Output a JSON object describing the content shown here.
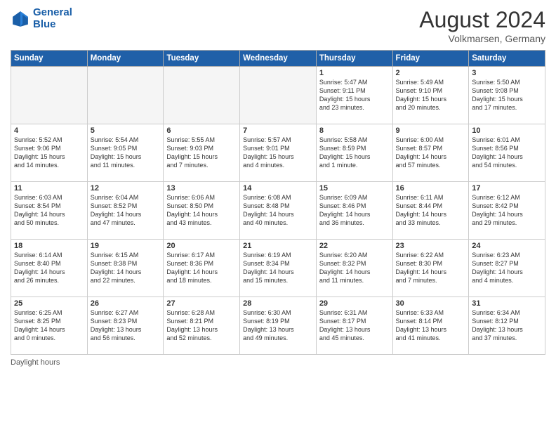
{
  "header": {
    "logo_line1": "General",
    "logo_line2": "Blue",
    "month_title": "August 2024",
    "location": "Volkmarsen, Germany"
  },
  "days_of_week": [
    "Sunday",
    "Monday",
    "Tuesday",
    "Wednesday",
    "Thursday",
    "Friday",
    "Saturday"
  ],
  "footer": {
    "label": "Daylight hours"
  },
  "weeks": [
    [
      {
        "day": "",
        "info": ""
      },
      {
        "day": "",
        "info": ""
      },
      {
        "day": "",
        "info": ""
      },
      {
        "day": "",
        "info": ""
      },
      {
        "day": "1",
        "info": "Sunrise: 5:47 AM\nSunset: 9:11 PM\nDaylight: 15 hours\nand 23 minutes."
      },
      {
        "day": "2",
        "info": "Sunrise: 5:49 AM\nSunset: 9:10 PM\nDaylight: 15 hours\nand 20 minutes."
      },
      {
        "day": "3",
        "info": "Sunrise: 5:50 AM\nSunset: 9:08 PM\nDaylight: 15 hours\nand 17 minutes."
      }
    ],
    [
      {
        "day": "4",
        "info": "Sunrise: 5:52 AM\nSunset: 9:06 PM\nDaylight: 15 hours\nand 14 minutes."
      },
      {
        "day": "5",
        "info": "Sunrise: 5:54 AM\nSunset: 9:05 PM\nDaylight: 15 hours\nand 11 minutes."
      },
      {
        "day": "6",
        "info": "Sunrise: 5:55 AM\nSunset: 9:03 PM\nDaylight: 15 hours\nand 7 minutes."
      },
      {
        "day": "7",
        "info": "Sunrise: 5:57 AM\nSunset: 9:01 PM\nDaylight: 15 hours\nand 4 minutes."
      },
      {
        "day": "8",
        "info": "Sunrise: 5:58 AM\nSunset: 8:59 PM\nDaylight: 15 hours\nand 1 minute."
      },
      {
        "day": "9",
        "info": "Sunrise: 6:00 AM\nSunset: 8:57 PM\nDaylight: 14 hours\nand 57 minutes."
      },
      {
        "day": "10",
        "info": "Sunrise: 6:01 AM\nSunset: 8:56 PM\nDaylight: 14 hours\nand 54 minutes."
      }
    ],
    [
      {
        "day": "11",
        "info": "Sunrise: 6:03 AM\nSunset: 8:54 PM\nDaylight: 14 hours\nand 50 minutes."
      },
      {
        "day": "12",
        "info": "Sunrise: 6:04 AM\nSunset: 8:52 PM\nDaylight: 14 hours\nand 47 minutes."
      },
      {
        "day": "13",
        "info": "Sunrise: 6:06 AM\nSunset: 8:50 PM\nDaylight: 14 hours\nand 43 minutes."
      },
      {
        "day": "14",
        "info": "Sunrise: 6:08 AM\nSunset: 8:48 PM\nDaylight: 14 hours\nand 40 minutes."
      },
      {
        "day": "15",
        "info": "Sunrise: 6:09 AM\nSunset: 8:46 PM\nDaylight: 14 hours\nand 36 minutes."
      },
      {
        "day": "16",
        "info": "Sunrise: 6:11 AM\nSunset: 8:44 PM\nDaylight: 14 hours\nand 33 minutes."
      },
      {
        "day": "17",
        "info": "Sunrise: 6:12 AM\nSunset: 8:42 PM\nDaylight: 14 hours\nand 29 minutes."
      }
    ],
    [
      {
        "day": "18",
        "info": "Sunrise: 6:14 AM\nSunset: 8:40 PM\nDaylight: 14 hours\nand 26 minutes."
      },
      {
        "day": "19",
        "info": "Sunrise: 6:15 AM\nSunset: 8:38 PM\nDaylight: 14 hours\nand 22 minutes."
      },
      {
        "day": "20",
        "info": "Sunrise: 6:17 AM\nSunset: 8:36 PM\nDaylight: 14 hours\nand 18 minutes."
      },
      {
        "day": "21",
        "info": "Sunrise: 6:19 AM\nSunset: 8:34 PM\nDaylight: 14 hours\nand 15 minutes."
      },
      {
        "day": "22",
        "info": "Sunrise: 6:20 AM\nSunset: 8:32 PM\nDaylight: 14 hours\nand 11 minutes."
      },
      {
        "day": "23",
        "info": "Sunrise: 6:22 AM\nSunset: 8:30 PM\nDaylight: 14 hours\nand 7 minutes."
      },
      {
        "day": "24",
        "info": "Sunrise: 6:23 AM\nSunset: 8:27 PM\nDaylight: 14 hours\nand 4 minutes."
      }
    ],
    [
      {
        "day": "25",
        "info": "Sunrise: 6:25 AM\nSunset: 8:25 PM\nDaylight: 14 hours\nand 0 minutes."
      },
      {
        "day": "26",
        "info": "Sunrise: 6:27 AM\nSunset: 8:23 PM\nDaylight: 13 hours\nand 56 minutes."
      },
      {
        "day": "27",
        "info": "Sunrise: 6:28 AM\nSunset: 8:21 PM\nDaylight: 13 hours\nand 52 minutes."
      },
      {
        "day": "28",
        "info": "Sunrise: 6:30 AM\nSunset: 8:19 PM\nDaylight: 13 hours\nand 49 minutes."
      },
      {
        "day": "29",
        "info": "Sunrise: 6:31 AM\nSunset: 8:17 PM\nDaylight: 13 hours\nand 45 minutes."
      },
      {
        "day": "30",
        "info": "Sunrise: 6:33 AM\nSunset: 8:14 PM\nDaylight: 13 hours\nand 41 minutes."
      },
      {
        "day": "31",
        "info": "Sunrise: 6:34 AM\nSunset: 8:12 PM\nDaylight: 13 hours\nand 37 minutes."
      }
    ]
  ]
}
